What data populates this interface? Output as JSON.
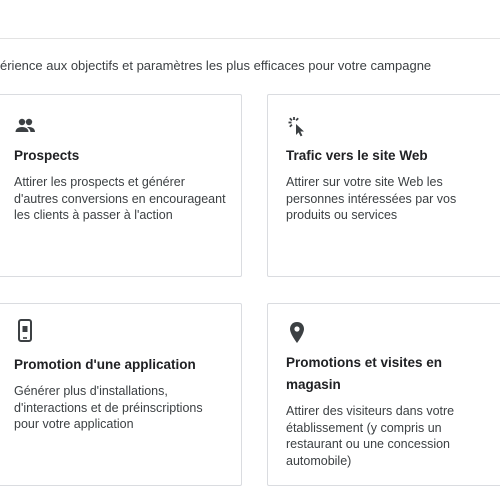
{
  "intro": {
    "text": "érience aux objectifs et paramètres les plus efficaces pour votre campagne"
  },
  "cards": [
    {
      "title": "Prospects",
      "description": "Attirer les prospects et générer d'autres conversions en encourageant les clients à passer à l'action",
      "icon": "people-icon"
    },
    {
      "title": "Trafic vers le site Web",
      "description": "Attirer sur votre site Web les personnes intéressées par vos produits ou services",
      "icon": "cursor-click-icon"
    },
    {
      "title": "Promotion d'une application",
      "description": "Générer plus d'installations, d'interactions et de préinscriptions pour votre application",
      "icon": "phone-app-icon"
    },
    {
      "title": "Promotions et visites en magasin",
      "description": "Attirer des visiteurs dans votre établissement (y compris un restaurant ou une concession automobile)",
      "icon": "location-pin-icon"
    }
  ],
  "colors": {
    "text": "#202124",
    "secondary_text": "#3c4043",
    "border": "#dadce0",
    "icon": "#3c4043"
  }
}
